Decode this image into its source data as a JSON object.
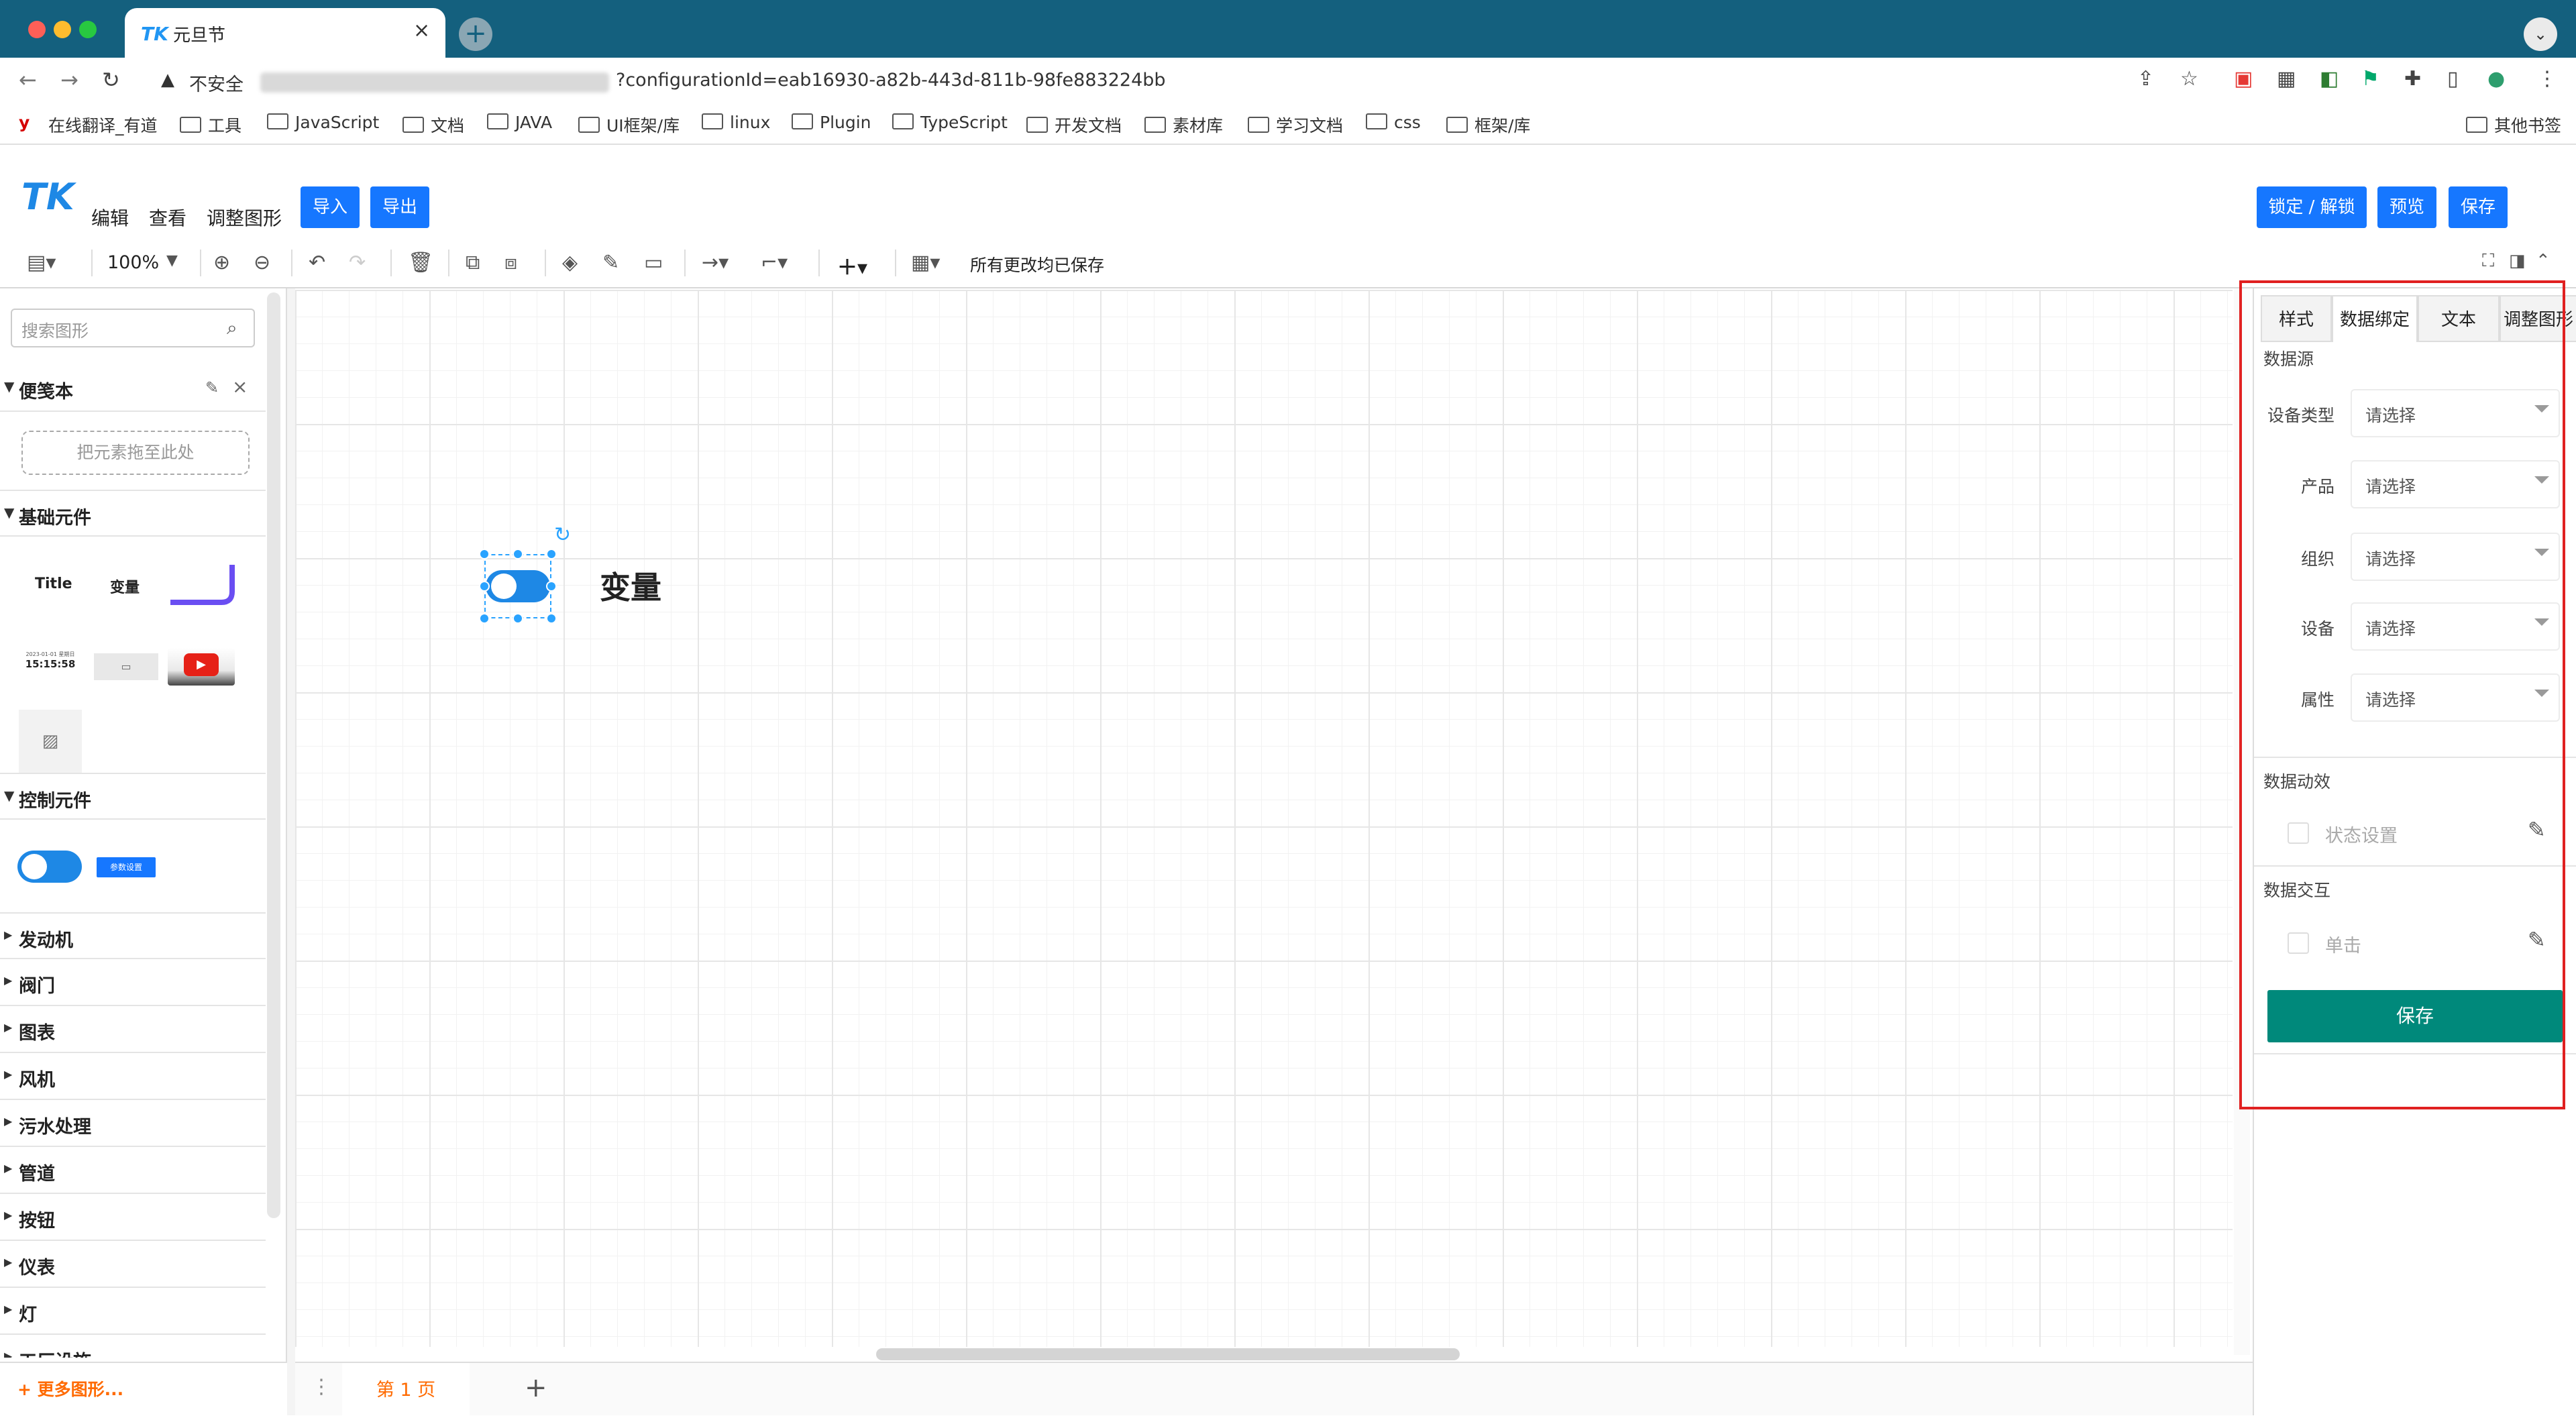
{
  "browser": {
    "tab_title": "元旦节",
    "tab_logo": "TK",
    "close_icon": "×",
    "new_tab_icon": "+",
    "insecure_label": "不安全",
    "url_visible": "?configurationId=eab16930-a82b-443d-811b-98fe883224bb",
    "bookmarks": [
      "在线翻译_有道",
      "工具",
      "JavaScript",
      "文档",
      "JAVA",
      "UI框架/库",
      "linux",
      "Plugin",
      "TypeScript",
      "开发文档",
      "素材库",
      "学习文档",
      "css",
      "框架/库"
    ],
    "other_bookmarks": "其他书签"
  },
  "app": {
    "logo": "TK",
    "menus": [
      "编辑",
      "查看",
      "调整图形"
    ],
    "import_label": "导入",
    "export_label": "导出",
    "lock_label": "锁定 / 解锁",
    "preview_label": "预览",
    "save_label": "保存"
  },
  "toolbar": {
    "zoom": "100%",
    "saved_status": "所有更改均已保存"
  },
  "sidebar": {
    "search_placeholder": "搜索图形",
    "scratchpad": {
      "title": "便笺本",
      "drop_hint": "把元素拖至此处"
    },
    "basic": {
      "title": "基础元件",
      "items": [
        "Title",
        "变量"
      ],
      "clock_caption": "2023-01-01 星期日",
      "clock_time": "15:15:58"
    },
    "control": {
      "title": "控制元件",
      "param_button": "参数设置"
    },
    "categories": [
      "发动机",
      "阀门",
      "图表",
      "风机",
      "污水处理",
      "管道",
      "按钮",
      "仪表",
      "灯",
      "工厂设施"
    ],
    "more_shapes": "+ 更多图形..."
  },
  "canvas": {
    "variable_label": "变量"
  },
  "pagebar": {
    "page_tab": "第 1 页",
    "add_icon": "+"
  },
  "panel": {
    "tabs": [
      "样式",
      "数据绑定",
      "文本",
      "调整图形"
    ],
    "datasource_title": "数据源",
    "fields": [
      {
        "label": "设备类型",
        "value": "请选择"
      },
      {
        "label": "产品",
        "value": "请选择"
      },
      {
        "label": "组织",
        "value": "请选择"
      },
      {
        "label": "设备",
        "value": "请选择"
      },
      {
        "label": "属性",
        "value": "请选择"
      }
    ],
    "animation_title": "数据动效",
    "animation_option": "状态设置",
    "interaction_title": "数据交互",
    "interaction_option": "单击",
    "save_button": "保存"
  },
  "colors": {
    "chrome": "#14607e",
    "primary": "#1677ff",
    "save_green": "#00897b",
    "highlight_red": "#e02020",
    "orange": "#ff6a00"
  }
}
